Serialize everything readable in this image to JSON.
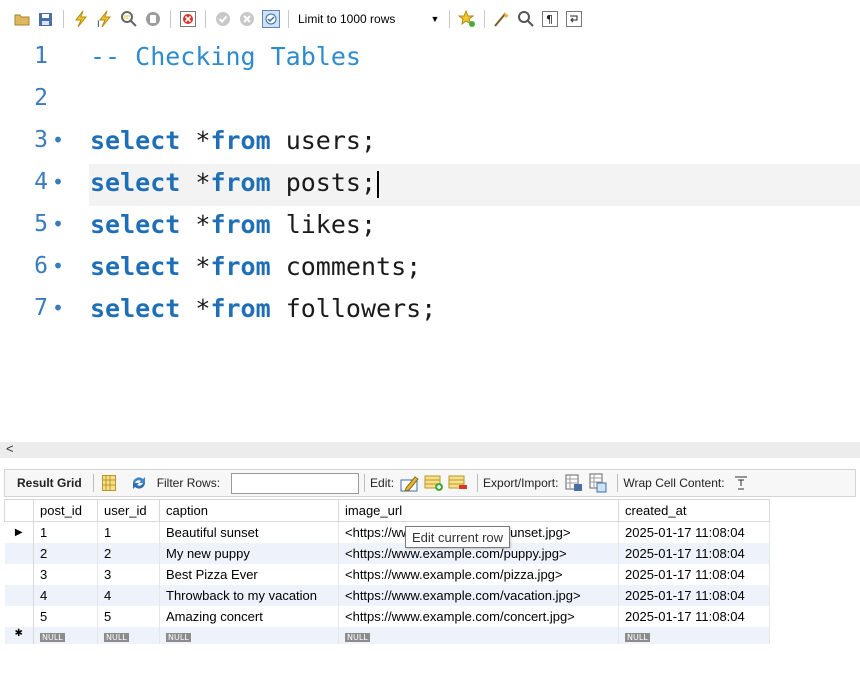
{
  "toolbar": {
    "limit_label": "Limit to 1000 rows"
  },
  "editor": {
    "lines": [
      {
        "number": "1",
        "text": "-- Checking Tables"
      },
      {
        "number": "2",
        "text": ""
      },
      {
        "number": "3",
        "keyword1": "select",
        "star": "*",
        "keyword2": "from",
        "rest": " users;"
      },
      {
        "number": "4",
        "keyword1": "select",
        "star": "*",
        "keyword2": "from",
        "rest": " posts;"
      },
      {
        "number": "5",
        "keyword1": "select",
        "star": "*",
        "keyword2": "from",
        "rest": " likes;"
      },
      {
        "number": "6",
        "keyword1": "select",
        "star": "*",
        "keyword2": "from",
        "rest": " comments;"
      },
      {
        "number": "7",
        "keyword1": "select",
        "star": "*",
        "keyword2": "from",
        "rest": " followers;"
      }
    ],
    "statement_marker": "•",
    "current_line": "4"
  },
  "result_toolbar": {
    "result_grid": "Result Grid",
    "filter_rows": "Filter Rows:",
    "edit": "Edit:",
    "export_import": "Export/Import:",
    "wrap_cell": "Wrap Cell Content:"
  },
  "grid": {
    "columns": [
      "post_id",
      "user_id",
      "caption",
      "image_url",
      "created_at"
    ],
    "rows": [
      [
        "1",
        "1",
        "Beautiful sunset",
        "<https://www.example.com/sunset.jpg>",
        "2025-01-17 11:08:04"
      ],
      [
        "2",
        "2",
        "My new puppy",
        "<https://www.example.com/puppy.jpg>",
        "2025-01-17 11:08:04"
      ],
      [
        "3",
        "3",
        "Best Pizza Ever",
        "<https://www.example.com/pizza.jpg>",
        "2025-01-17 11:08:04"
      ],
      [
        "4",
        "4",
        "Throwback to my vacation",
        "<https://www.example.com/vacation.jpg>",
        "2025-01-17 11:08:04"
      ],
      [
        "5",
        "5",
        "Amazing concert",
        "<https://www.example.com/concert.jpg>",
        "2025-01-17 11:08:04"
      ]
    ],
    "null_label": "NULL",
    "current_row_marker": "▶",
    "new_row_marker": "✱"
  },
  "tooltip": "Edit current row",
  "icons": [
    "folder-icon",
    "save-icon",
    "execute-icon",
    "execute-current-icon",
    "explain-icon",
    "stop-icon",
    "toggle-error-icon",
    "commit-icon",
    "rollback-icon",
    "autocommit-icon",
    "bookmark-icon",
    "beautify-icon",
    "find-icon",
    "invisible-chars-icon",
    "wrap-icon"
  ]
}
